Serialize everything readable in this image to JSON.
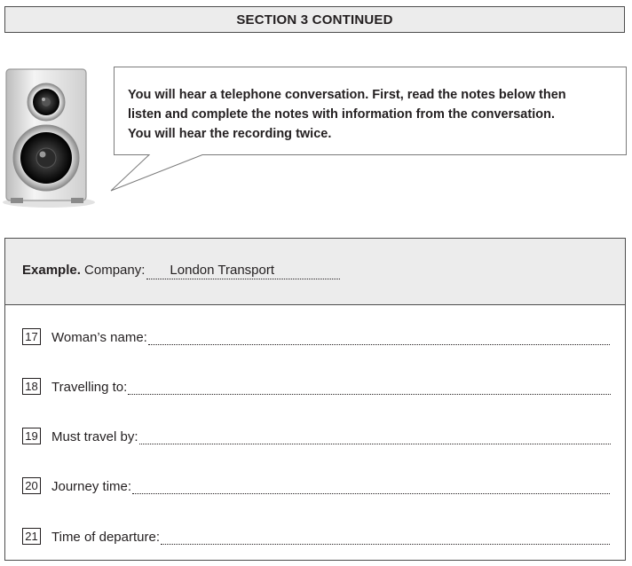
{
  "header": {
    "title": "SECTION 3 CONTINUED"
  },
  "instructions": {
    "line1": "You will hear a telephone conversation. First, read the notes below then",
    "line2": "listen and complete the notes with information from the conversation.",
    "line3": "You will hear the recording twice."
  },
  "icons": {
    "speaker": "speaker-icon",
    "bubble": "speech-bubble"
  },
  "example": {
    "prefix": "Example.",
    "label": "Company:",
    "answer": "London Transport"
  },
  "items": [
    {
      "number": "17",
      "label": "Woman’s name:"
    },
    {
      "number": "18",
      "label": "Travelling to:"
    },
    {
      "number": "19",
      "label": "Must travel by:"
    },
    {
      "number": "20",
      "label": "Journey time:"
    },
    {
      "number": "21",
      "label": "Time of departure:"
    }
  ]
}
